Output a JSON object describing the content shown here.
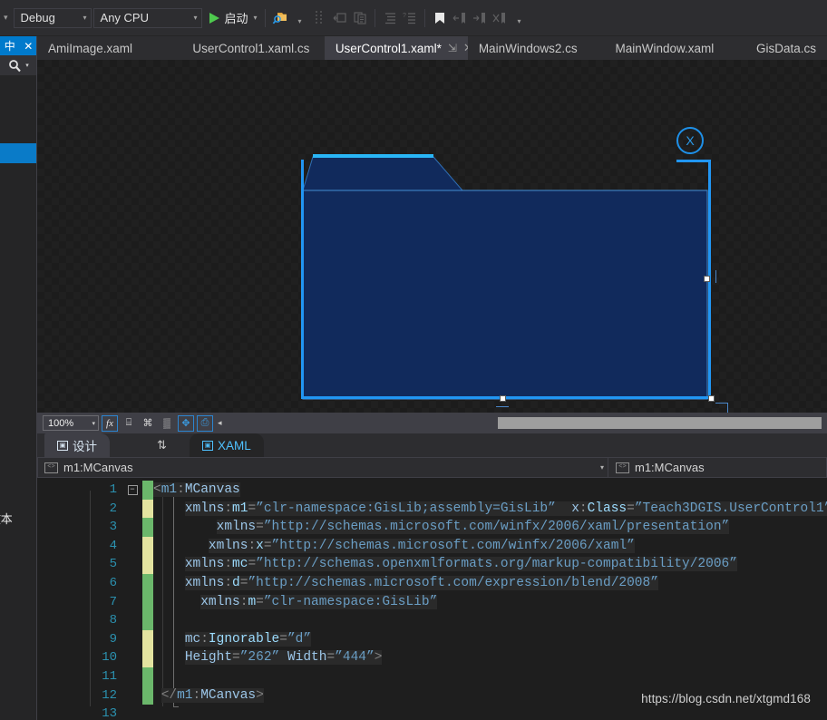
{
  "toolbar": {
    "config_combo": {
      "value": "Debug",
      "caret": "▾"
    },
    "platform_combo": {
      "value": "Any CPU",
      "caret": "▾"
    },
    "start_button": {
      "label": "启动",
      "caret": "▾"
    },
    "icons": [
      "search-folder-icon",
      "dropdown-caret-icon",
      "grid-dots-icon",
      "step-into-icon",
      "copy-lines-icon",
      "indent-icon",
      "outdent-icon",
      "bookmark-icon",
      "prev-bookmark-icon",
      "next-bookmark-icon",
      "clear-bookmarks-icon",
      "overflow-caret-icon"
    ],
    "accent_color": "#007acc",
    "play_color": "#4ec94e"
  },
  "tabs": [
    {
      "label": "AmiImage.xaml",
      "state": "inactive",
      "closable": false
    },
    {
      "label": "UserControl1.xaml.cs",
      "state": "inactive",
      "closable": false
    },
    {
      "label": "UserControl1.xaml*",
      "state": "active",
      "closable": true,
      "pin": "⇲",
      "close": "✕"
    },
    {
      "label": "MainWindows2.cs",
      "state": "inactive",
      "closable": false
    },
    {
      "label": "MainWindow.xaml",
      "state": "inactive",
      "closable": false
    },
    {
      "label": "GisData.cs",
      "state": "inactive",
      "closable": false
    }
  ],
  "left_dock": {
    "pin_icon": "中",
    "close_icon": "✕",
    "search_icon": "search-icon",
    "search_caret": "▾",
    "partial_text": "文本",
    "header_color": "#007acc",
    "highlight_color": "#0a7bc8"
  },
  "designer": {
    "shape": {
      "name": "folder-graphic",
      "fill": "#112a5c",
      "stroke": "#2196f3",
      "tab_stroke": "#29b6f6"
    },
    "close_badge": {
      "label": "X",
      "color": "#2b9ae8"
    },
    "selection": {
      "handle_fill": "#ffffff",
      "edge_color": "#2196f3"
    }
  },
  "zoombar": {
    "zoom_value": "100%",
    "zoom_caret": "▾",
    "icons": [
      {
        "name": "effects-fx-button",
        "glyph": "fx",
        "active": true
      },
      {
        "name": "grid-button",
        "glyph": "⌸",
        "active": false
      },
      {
        "name": "snap-to-gridlines-button",
        "glyph": "⌘",
        "active": false
      },
      {
        "name": "transparency-button",
        "glyph": "▒",
        "active": false
      },
      {
        "name": "snap-to-objects-button",
        "glyph": "✥",
        "active": true
      },
      {
        "name": "show-code-button",
        "glyph": "⎙",
        "active": true
      }
    ],
    "overflow_arrow": "◂"
  },
  "view_tabs": {
    "design": {
      "label": "设计",
      "icon": "design-view-icon",
      "active": true
    },
    "swap": {
      "label": "⇅",
      "name": "swap-panes-button"
    },
    "xaml": {
      "label": "XAML",
      "icon": "xaml-view-icon",
      "active": false
    }
  },
  "breadcrumb": {
    "left": {
      "value": "m1:MCanvas",
      "icon": "element-icon",
      "caret": "▾"
    },
    "right": {
      "value": "m1:MCanvas",
      "icon": "element-icon",
      "caret": "▾"
    }
  },
  "editor": {
    "line_numbers": [
      "1",
      "2",
      "3",
      "4",
      "5",
      "6",
      "7",
      "8",
      "9",
      "10",
      "11",
      "12",
      "13"
    ],
    "change_marks": [
      "g",
      "y",
      "g",
      "y",
      "y",
      "g",
      "g",
      "g",
      "y",
      "y",
      "g",
      "g",
      ""
    ],
    "fold_markers": {
      "1": "−"
    },
    "lines": [
      {
        "n": 1,
        "indent": 0,
        "segments": [
          {
            "t": "<",
            "c": "punct"
          },
          {
            "t": "m1",
            "c": "ns"
          },
          {
            "t": ":",
            "c": "punct"
          },
          {
            "t": "MCanvas",
            "c": "tag"
          }
        ]
      },
      {
        "n": 2,
        "indent": 4,
        "segments": [
          {
            "t": "xmlns",
            "c": "tag"
          },
          {
            "t": ":",
            "c": "punct"
          },
          {
            "t": "m1",
            "c": "attr"
          },
          {
            "t": "=",
            "c": "punct"
          },
          {
            "t": "”clr-namespace:GisLib;assembly=GisLib”",
            "c": "str"
          },
          {
            "t": "  ",
            "c": "punct"
          },
          {
            "t": "x",
            "c": "tag"
          },
          {
            "t": ":",
            "c": "punct"
          },
          {
            "t": "Class",
            "c": "attr"
          },
          {
            "t": "=",
            "c": "punct"
          },
          {
            "t": "”Teach3DGIS.UserControl1”",
            "c": "str"
          }
        ]
      },
      {
        "n": 3,
        "indent": 8,
        "segments": [
          {
            "t": "xmlns",
            "c": "tag"
          },
          {
            "t": "=",
            "c": "punct"
          },
          {
            "t": "”http://schemas.microsoft.com/winfx/2006/xaml/presentation”",
            "c": "str"
          }
        ]
      },
      {
        "n": 4,
        "indent": 7,
        "segments": [
          {
            "t": "xmlns",
            "c": "tag"
          },
          {
            "t": ":",
            "c": "punct"
          },
          {
            "t": "x",
            "c": "attr"
          },
          {
            "t": "=",
            "c": "punct"
          },
          {
            "t": "”http://schemas.microsoft.com/winfx/2006/xaml”",
            "c": "str"
          }
        ]
      },
      {
        "n": 5,
        "indent": 4,
        "segments": [
          {
            "t": "xmlns",
            "c": "tag"
          },
          {
            "t": ":",
            "c": "punct"
          },
          {
            "t": "mc",
            "c": "attr"
          },
          {
            "t": "=",
            "c": "punct"
          },
          {
            "t": "”http://schemas.openxmlformats.org/markup-compatibility/2006”",
            "c": "str"
          }
        ]
      },
      {
        "n": 6,
        "indent": 4,
        "segments": [
          {
            "t": "xmlns",
            "c": "tag"
          },
          {
            "t": ":",
            "c": "punct"
          },
          {
            "t": "d",
            "c": "attr"
          },
          {
            "t": "=",
            "c": "punct"
          },
          {
            "t": "”http://schemas.microsoft.com/expression/blend/2008”",
            "c": "str"
          }
        ]
      },
      {
        "n": 7,
        "indent": 6,
        "segments": [
          {
            "t": "xmlns",
            "c": "tag"
          },
          {
            "t": ":",
            "c": "punct"
          },
          {
            "t": "m",
            "c": "attr"
          },
          {
            "t": "=",
            "c": "punct"
          },
          {
            "t": "”clr-namespace:GisLib”",
            "c": "str"
          }
        ]
      },
      {
        "n": 8,
        "indent": 4,
        "segments": []
      },
      {
        "n": 9,
        "indent": 4,
        "segments": [
          {
            "t": "mc",
            "c": "tag"
          },
          {
            "t": ":",
            "c": "punct"
          },
          {
            "t": "Ignorable",
            "c": "attr"
          },
          {
            "t": "=",
            "c": "punct"
          },
          {
            "t": "”d”",
            "c": "str"
          }
        ]
      },
      {
        "n": 10,
        "indent": 4,
        "segments": [
          {
            "t": "Height",
            "c": "tag"
          },
          {
            "t": "=",
            "c": "punct"
          },
          {
            "t": "”262”",
            "c": "str"
          },
          {
            "t": " ",
            "c": "punct"
          },
          {
            "t": "Width",
            "c": "tag"
          },
          {
            "t": "=",
            "c": "punct"
          },
          {
            "t": "”444”",
            "c": "str"
          },
          {
            "t": ">",
            "c": "brace"
          }
        ]
      },
      {
        "n": 11,
        "indent": 0,
        "segments": []
      },
      {
        "n": 12,
        "indent": 1,
        "segments": [
          {
            "t": "</",
            "c": "brace"
          },
          {
            "t": "m1",
            "c": "ns"
          },
          {
            "t": ":",
            "c": "punct"
          },
          {
            "t": "MCanvas",
            "c": "tag"
          },
          {
            "t": ">",
            "c": "brace"
          }
        ]
      },
      {
        "n": 13,
        "indent": 0,
        "segments": []
      }
    ]
  },
  "watermark": "https://blog.csdn.net/xtgmd168"
}
